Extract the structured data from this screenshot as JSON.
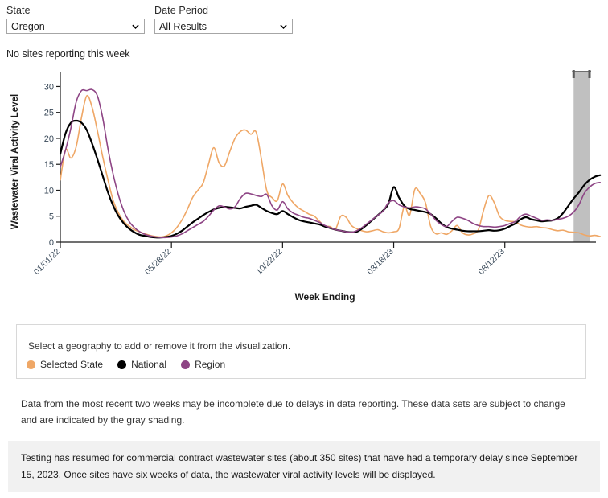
{
  "controls": {
    "state": {
      "label": "State",
      "value": "Oregon",
      "icon": "chevron-down-icon"
    },
    "date_period": {
      "label": "Date Period",
      "value": "All Results",
      "icon": "chevron-down-icon"
    }
  },
  "status_note": "No sites reporting this week",
  "legend": {
    "instruction": "Select a geography to add or remove it from the visualization.",
    "items": [
      {
        "label": "Selected State",
        "color": "# efa766"
      },
      {
        "label": "National",
        "color": "#000000"
      },
      {
        "label": "Region",
        "color": "#8e4585"
      }
    ]
  },
  "footnote": "Data from the most recent two weeks may be incomplete due to delays in data reporting. These data sets are subject to change and are indicated by the gray shading.",
  "alert": "Testing has resumed for commercial contract wastewater sites (about 350 sites) that have had a temporary delay since September 15, 2023. Once sites have six weeks of data, the wastewater viral activity levels will be displayed.",
  "colors": {
    "selected_state": "#efa766",
    "national": "#000000",
    "region": "#8e4585",
    "gray_shading": "#c0c0c0",
    "axis": "#1a1a1a",
    "tick_label": "#3a4a5a",
    "panel_border": "#d8d8d8",
    "banner_bg": "#f1f1f1"
  },
  "chart_data": {
    "type": "line",
    "title": "",
    "xlabel": "Week Ending",
    "ylabel": "Wastewater Viral Activity Level",
    "ylim": [
      0,
      31
    ],
    "yticks": [
      0,
      5,
      10,
      15,
      20,
      25,
      30
    ],
    "xticks": [
      "01/01/22",
      "05/28/22",
      "10/22/22",
      "03/18/23",
      "08/12/23"
    ],
    "xtick_index": [
      0,
      21,
      42,
      63,
      84
    ],
    "grid": false,
    "legend_position": "below",
    "shaded_region": {
      "label": "Incomplete data (most recent two weeks)",
      "color": "#c0c0c0",
      "start_index": 97,
      "end_index": 100
    },
    "n_points": 101,
    "series": [
      {
        "name": "Selected State",
        "color": "#efa766",
        "values": [
          12.0,
          17.8,
          16.2,
          18.4,
          24.0,
          28.2,
          26.0,
          21.5,
          16.5,
          12.0,
          8.0,
          5.6,
          4.0,
          3.1,
          2.4,
          2.0,
          1.6,
          1.3,
          1.1,
          1.0,
          1.2,
          1.8,
          2.8,
          4.3,
          6.3,
          8.6,
          10.0,
          11.4,
          15.0,
          18.2,
          15.3,
          14.7,
          17.4,
          20.0,
          21.3,
          21.6,
          20.8,
          21.2,
          16.0,
          10.0,
          8.6,
          8.0,
          11.2,
          9.0,
          7.6,
          6.6,
          6.0,
          5.4,
          5.0,
          4.0,
          3.1,
          3.0,
          2.5,
          5.0,
          4.8,
          3.2,
          2.6,
          2.2,
          2.0,
          2.2,
          2.4,
          2.0,
          1.8,
          2.0,
          2.6,
          6.9,
          5.2,
          10.2,
          9.4,
          7.6,
          3.0,
          1.6,
          1.8,
          1.5,
          2.2,
          3.2,
          1.8,
          1.4,
          1.6,
          2.4,
          6.2,
          9.0,
          7.6,
          5.0,
          4.2,
          4.0,
          3.9,
          3.3,
          3.0,
          2.9,
          3.0,
          2.8,
          2.7,
          2.4,
          2.2,
          2.3,
          2.0,
          1.9,
          1.8,
          1.4,
          1.2,
          1.3,
          1.1
        ]
      },
      {
        "name": "National",
        "color": "#000000",
        "values": [
          17.0,
          21.0,
          23.0,
          23.4,
          23.0,
          21.6,
          19.0,
          16.0,
          12.8,
          9.6,
          7.0,
          5.0,
          3.6,
          2.6,
          1.9,
          1.4,
          1.2,
          1.0,
          0.9,
          0.9,
          1.0,
          1.2,
          1.6,
          2.2,
          3.0,
          3.8,
          4.5,
          5.2,
          5.8,
          6.3,
          6.6,
          6.8,
          6.7,
          6.6,
          6.5,
          6.8,
          7.0,
          7.2,
          6.6,
          6.0,
          5.6,
          5.4,
          6.0,
          5.4,
          4.8,
          4.3,
          4.0,
          3.8,
          3.6,
          3.4,
          3.0,
          2.7,
          2.4,
          2.2,
          2.0,
          1.9,
          2.0,
          2.6,
          3.4,
          4.3,
          5.2,
          6.1,
          7.4,
          10.6,
          8.6,
          7.0,
          6.4,
          6.2,
          6.0,
          5.8,
          5.4,
          4.6,
          3.6,
          2.9,
          2.6,
          2.4,
          2.2,
          2.1,
          2.1,
          2.1,
          2.2,
          2.3,
          2.2,
          2.3,
          2.6,
          3.1,
          3.6,
          4.4,
          4.8,
          4.4,
          4.2,
          4.0,
          4.1,
          4.2,
          4.6,
          5.6,
          7.0,
          8.4,
          9.6,
          11.0,
          12.0,
          12.6,
          12.9
        ]
      },
      {
        "name": "Region",
        "color": "#8e4585",
        "values": [
          14.5,
          17.8,
          22.0,
          27.0,
          29.2,
          29.2,
          29.4,
          28.2,
          24.0,
          18.0,
          13.0,
          9.0,
          6.0,
          4.0,
          2.8,
          2.0,
          1.5,
          1.2,
          1.0,
          0.9,
          0.9,
          1.0,
          1.2,
          1.6,
          2.2,
          2.8,
          3.4,
          4.0,
          5.0,
          6.2,
          7.0,
          6.8,
          6.4,
          6.8,
          8.4,
          9.4,
          9.3,
          9.0,
          8.8,
          9.2,
          7.0,
          6.2,
          7.8,
          6.4,
          5.6,
          5.2,
          4.8,
          4.6,
          4.2,
          3.8,
          3.2,
          2.8,
          2.4,
          2.2,
          2.0,
          1.9,
          2.2,
          2.8,
          3.6,
          4.4,
          5.2,
          6.0,
          7.6,
          8.0,
          7.2,
          6.8,
          6.6,
          6.8,
          6.7,
          6.4,
          5.4,
          4.2,
          3.4,
          3.0,
          4.0,
          4.8,
          4.6,
          4.2,
          3.6,
          3.2,
          3.0,
          3.0,
          2.9,
          3.0,
          3.2,
          3.6,
          4.0,
          5.0,
          5.4,
          5.0,
          4.6,
          4.2,
          4.3,
          4.2,
          4.4,
          4.6,
          5.0,
          5.8,
          7.2,
          9.4,
          10.6,
          11.3,
          11.5
        ]
      }
    ]
  }
}
